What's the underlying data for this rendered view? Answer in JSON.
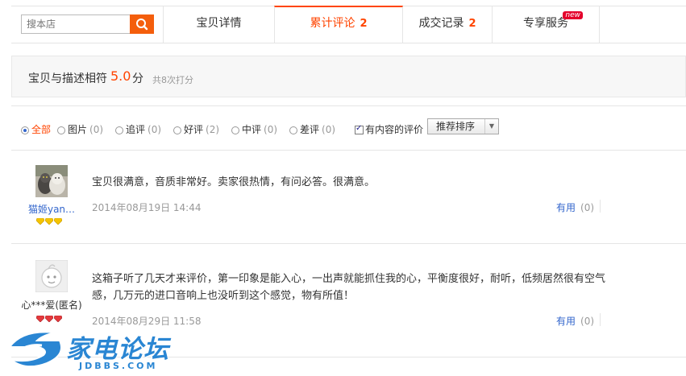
{
  "search": {
    "placeholder": "搜本店"
  },
  "tabs": [
    {
      "label": "宝贝详情",
      "count": "",
      "badge": ""
    },
    {
      "label": "累计评论",
      "count": "2",
      "badge": ""
    },
    {
      "label": "成交记录",
      "count": "2",
      "badge": ""
    },
    {
      "label": "专享服务",
      "count": "",
      "badge": "new"
    }
  ],
  "active_tab": "累计评论",
  "rating": {
    "label": "宝贝与描述相符",
    "value": "5.0",
    "unit": "分",
    "note": "共8次打分"
  },
  "filters": {
    "items": [
      {
        "label": "全部",
        "count": "",
        "selected": true
      },
      {
        "label": "图片",
        "count": "(0)",
        "selected": false
      },
      {
        "label": "追评",
        "count": "(0)",
        "selected": false
      },
      {
        "label": "好评",
        "count": "(2)",
        "selected": false
      },
      {
        "label": "中评",
        "count": "(0)",
        "selected": false
      },
      {
        "label": "差评",
        "count": "(0)",
        "selected": false
      }
    ],
    "content_only": {
      "label": "有内容的评价",
      "checked": true
    },
    "sort": "推荐排序"
  },
  "reviews": [
    {
      "user": "猫姬yan…",
      "badge_count": 3,
      "badge_color": "#f5c400",
      "text": "宝贝很满意，音质非常好。卖家很热情，有问必答。很满意。",
      "date": "2014年08月19日 14:44",
      "useful_label": "有用",
      "useful_count": "(0)"
    },
    {
      "user": "心***爱(匿名)",
      "badge_count": 3,
      "badge_color": "#e4393c",
      "text": "这箱子听了几天才来评价，第一印象是能入心，一出声就能抓住我的心，平衡度很好，耐听，低频居然很有空气感，几万元的进口音响上也没听到这个感觉，物有所值！",
      "date": "2014年08月29日 11:58",
      "useful_label": "有用",
      "useful_count": "(0)"
    }
  ],
  "watermark": {
    "title": "家电论坛",
    "domain": "JDBBS.COM"
  },
  "colors": {
    "accent": "#f40",
    "link": "#3366cc",
    "muted": "#999999"
  }
}
